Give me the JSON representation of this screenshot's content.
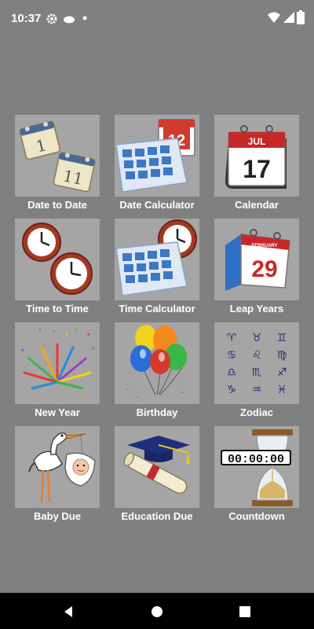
{
  "status_bar": {
    "time": "10:37",
    "icons": [
      "gear-icon",
      "cloud-icon",
      "dot-icon",
      "wifi-icon",
      "signal-icon",
      "battery-icon"
    ]
  },
  "tiles": [
    {
      "label": "Date to Date",
      "icon": "date-to-date-icon"
    },
    {
      "label": "Date Calculator",
      "icon": "date-calculator-icon",
      "calendar_text": "12"
    },
    {
      "label": "Calendar",
      "icon": "calendar-icon",
      "month": "JUL",
      "day": "17"
    },
    {
      "label": "Time to Time",
      "icon": "time-to-time-icon"
    },
    {
      "label": "Time Calculator",
      "icon": "time-calculator-icon"
    },
    {
      "label": "Leap Years",
      "icon": "leap-years-icon",
      "month": "FEBRUARY",
      "day": "29"
    },
    {
      "label": "New Year",
      "icon": "fireworks-icon"
    },
    {
      "label": "Birthday",
      "icon": "balloons-icon"
    },
    {
      "label": "Zodiac",
      "icon": "zodiac-icon",
      "symbols": [
        "♈",
        "♉",
        "♊",
        "♋",
        "♌",
        "♍",
        "♎",
        "♏",
        "♐",
        "♑",
        "♒",
        "♓"
      ]
    },
    {
      "label": "Baby Due",
      "icon": "stork-icon"
    },
    {
      "label": "Education Due",
      "icon": "graduation-icon"
    },
    {
      "label": "Countdown",
      "icon": "hourglass-icon",
      "timer": "00:00:00"
    }
  ],
  "navbar": {
    "buttons": [
      "back-icon",
      "home-icon",
      "recents-icon"
    ]
  },
  "colors": {
    "background": "#808080",
    "tile": "#a5a5a5",
    "navbar": "#000000"
  }
}
